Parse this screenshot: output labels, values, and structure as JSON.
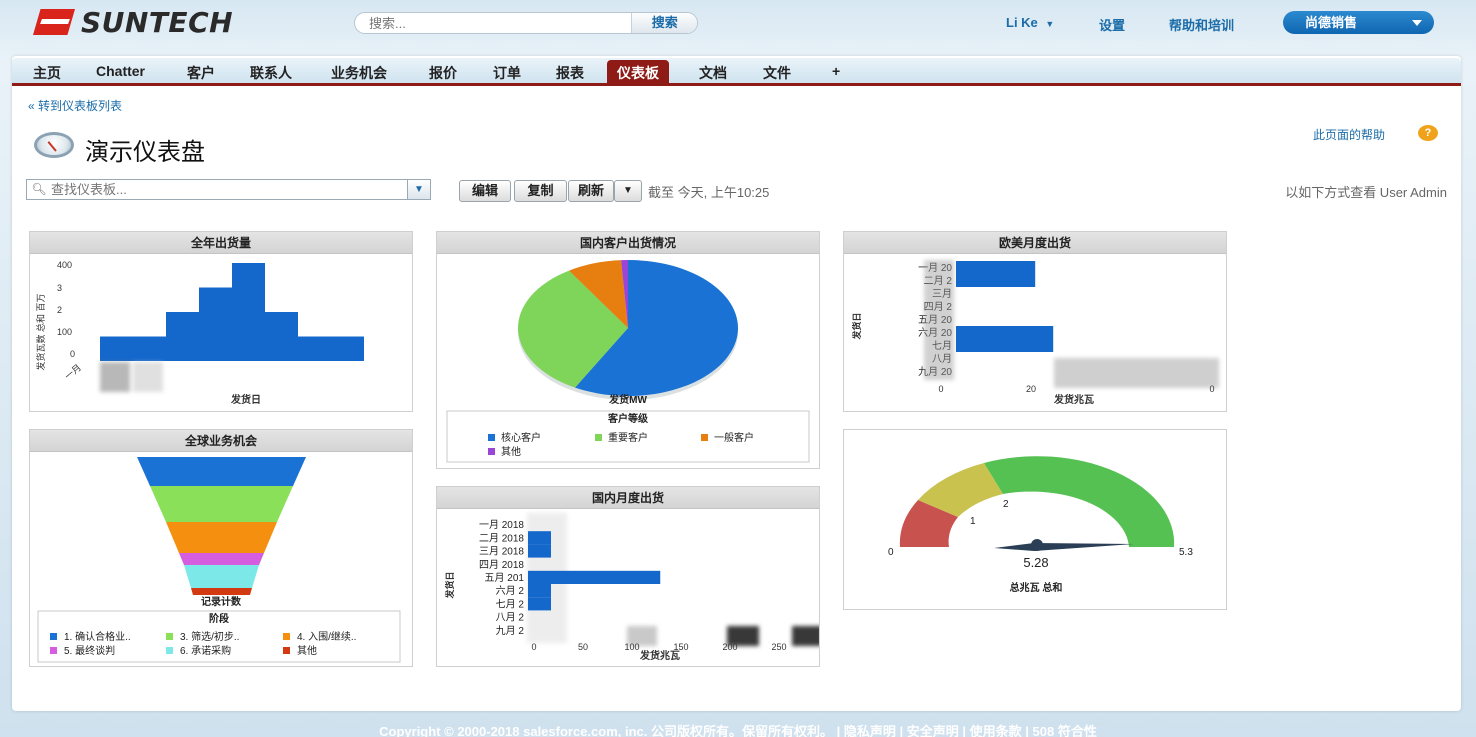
{
  "brand": {
    "logo_text": "SUNTECH",
    "accent": "#d9241b"
  },
  "search": {
    "placeholder": "搜索...",
    "button": "搜索"
  },
  "header": {
    "user": "Li Ke",
    "setup": "设置",
    "help": "帮助和培训",
    "app": "尚德销售"
  },
  "tabs": [
    "主页",
    "Chatter",
    "客户",
    "联系人",
    "业务机会",
    "报价",
    "订单",
    "报表",
    "仪表板",
    "文档",
    "文件",
    "+"
  ],
  "active_tab": "仪表板",
  "back_link": "« 转到仪表板列表",
  "page_title": "演示仪表盘",
  "page_help": "此页面的帮助",
  "dashboard_search": {
    "placeholder": "查找仪表板..."
  },
  "toolbar": {
    "edit": "编辑",
    "clone": "复制",
    "refresh": "刷新",
    "as_of": "截至 今天, 上午10:25",
    "view_as": "以如下方式查看 User Admin"
  },
  "components": {
    "annual_shipment": {
      "title": "全年出货量",
      "ylabel": "发货瓦数 总和 百万",
      "xlabel": "发货日",
      "y_ticks": [
        "400",
        "3",
        "2",
        "100",
        "0"
      ],
      "x_tick_first": "一月"
    },
    "domestic_customers": {
      "title": "国内客户出货情况",
      "value_label": "发货MW",
      "legend_title": "客户等级",
      "legend": [
        "核心客户",
        "重要客户",
        "一般客户",
        "其他"
      ]
    },
    "eu_us_monthly": {
      "title": "欧美月度出货",
      "ylabel": "发货日",
      "xlabel": "发货兆瓦",
      "categories": [
        "一月 20",
        "二月 2",
        "三月",
        "四月 2",
        "五月 20",
        "六月 20",
        "七月",
        "八月",
        "九月 20"
      ],
      "x_ticks": [
        "0",
        "20",
        "0"
      ]
    },
    "global_opportunities": {
      "title": "全球业务机会",
      "xlabel": "记录计数",
      "legend_title": "阶段",
      "legend": [
        "1. 确认合格业..",
        "3. 筛选/初步..",
        "4. 入围/继续..",
        "5. 最终谈判",
        "6. 承诺采购",
        "其他"
      ]
    },
    "domestic_monthly": {
      "title": "国内月度出货",
      "ylabel": "发货日",
      "xlabel": "发货兆瓦",
      "categories": [
        "一月 2018",
        "二月 2018",
        "三月 2018",
        "四月 2018",
        "五月 201",
        "六月 2",
        "七月 2",
        "八月 2",
        "九月 2"
      ],
      "x_ticks": [
        "0",
        "50",
        "100",
        "150",
        "200",
        "250"
      ]
    },
    "gauge": {
      "value": "5.28",
      "min": "0",
      "max": "5.3",
      "mark1": "1",
      "mark2": "2",
      "label": "总兆瓦 总和"
    }
  },
  "chart_data": [
    {
      "type": "bar",
      "title": "全年出货量",
      "xlabel": "发货日",
      "ylabel": "发货瓦数 总和 百万",
      "ylim": [
        0,
        400
      ],
      "series": [
        {
          "values": [
            100,
            100,
            200,
            300,
            400,
            200,
            100,
            100,
            0
          ]
        }
      ]
    },
    {
      "type": "pie",
      "title": "国内客户出货情况",
      "categories": [
        "核心客户",
        "重要客户",
        "一般客户",
        "其他"
      ],
      "values": [
        58,
        33,
        8,
        1
      ],
      "colors": [
        "#1a73d4",
        "#7fd45a",
        "#e67e10",
        "#9b45d6"
      ]
    },
    {
      "type": "bar",
      "orientation": "horizontal",
      "title": "欧美月度出货",
      "xlabel": "发货兆瓦",
      "categories": [
        "一月",
        "二月",
        "三月",
        "四月",
        "五月",
        "六月",
        "七月",
        "八月",
        "九月"
      ],
      "values": [
        22,
        22,
        0,
        0,
        0,
        27,
        27,
        0,
        0
      ]
    },
    {
      "type": "bar",
      "orientation": "horizontal",
      "title": "国内月度出货",
      "xlabel": "发货兆瓦",
      "categories": [
        "一月",
        "二月",
        "三月",
        "四月",
        "五月",
        "六月",
        "七月",
        "八月",
        "九月"
      ],
      "values": [
        0,
        20,
        20,
        0,
        115,
        20,
        20,
        0,
        0
      ]
    }
  ]
}
